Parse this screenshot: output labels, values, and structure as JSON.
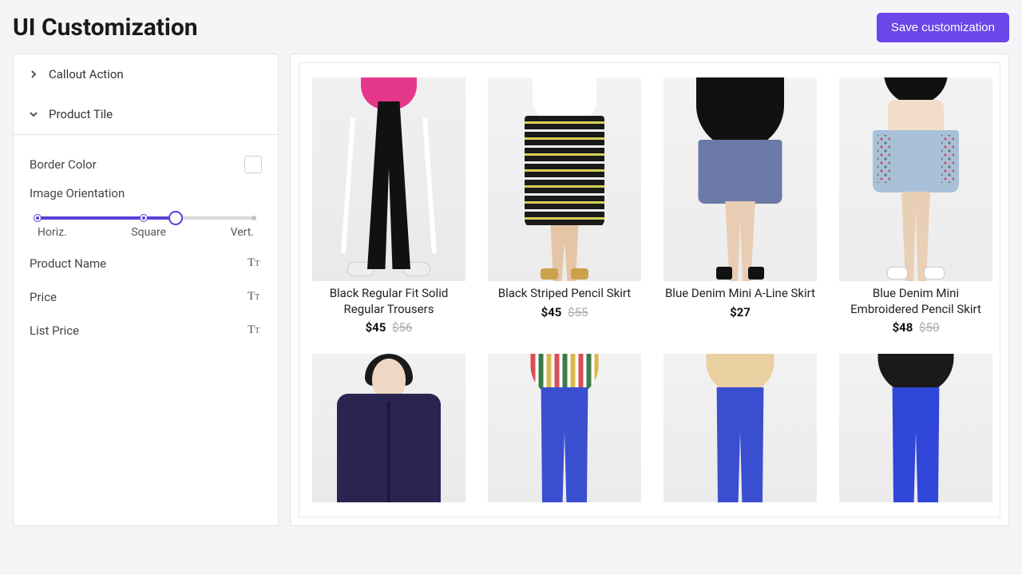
{
  "header": {
    "title": "UI Customization",
    "save_label": "Save customization"
  },
  "sidebar": {
    "sections": {
      "callout_action": "Callout Action",
      "product_tile": "Product Tile"
    },
    "controls": {
      "border_color": "Border Color",
      "image_orientation": "Image Orientation",
      "orient_labels": {
        "horiz": "Horiz.",
        "square": "Square",
        "vert": "Vert."
      },
      "product_name": "Product Name",
      "price": "Price",
      "list_price": "List Price"
    }
  },
  "products": [
    {
      "name": "Black Regular Fit Solid Regular Trousers",
      "price": "$45",
      "list": "$56"
    },
    {
      "name": "Black Striped Pencil Skirt",
      "price": "$45",
      "list": "$55"
    },
    {
      "name": "Blue Denim Mini A-Line Skirt",
      "price": "$27",
      "list": ""
    },
    {
      "name": "Blue Denim Mini Embroidered Pencil Skirt",
      "price": "$48",
      "list": "$50"
    }
  ]
}
